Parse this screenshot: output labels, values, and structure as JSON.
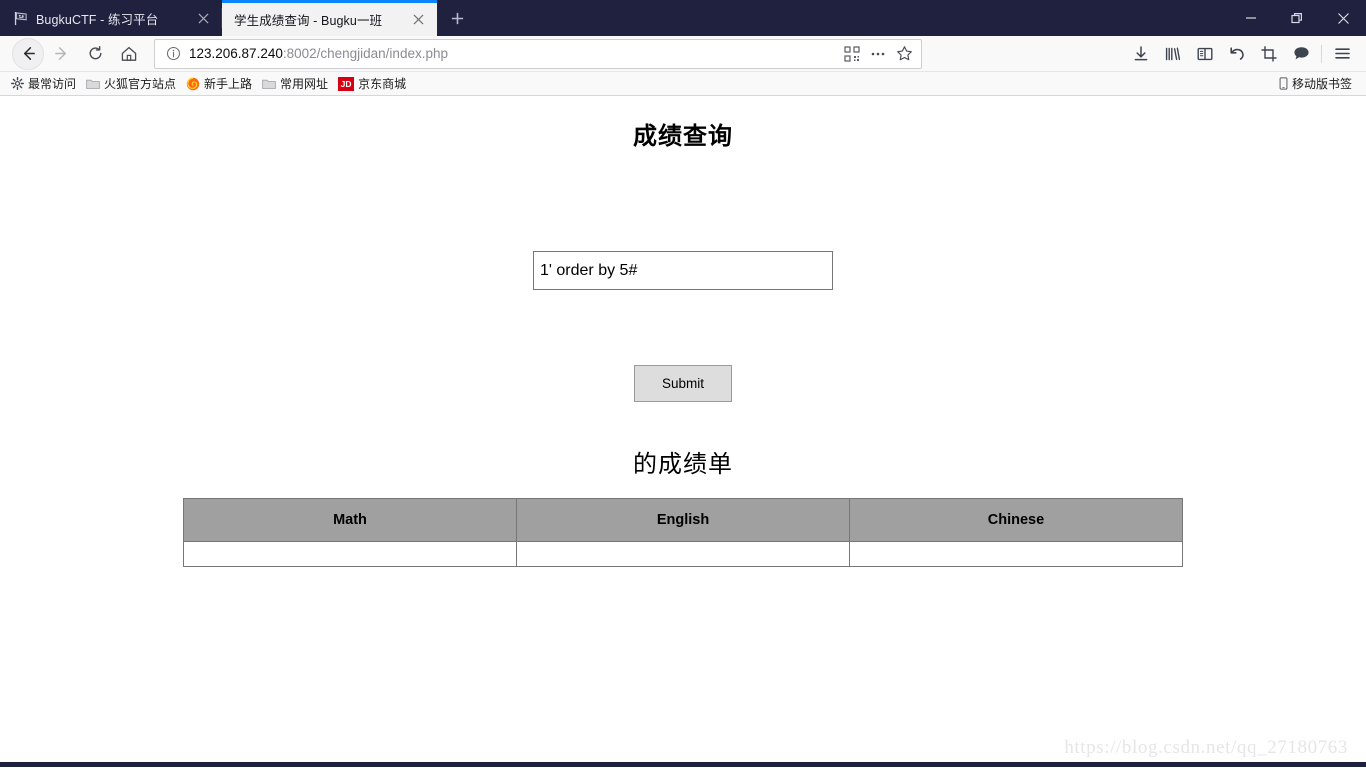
{
  "browser": {
    "tabs": [
      {
        "title": "BugkuCTF - 练习平台",
        "favicon": "pirate-flag-icon",
        "active": false,
        "close_label": "✕"
      },
      {
        "title": "学生成绩查询 - Bugku一班",
        "favicon": "page-icon",
        "active": true,
        "close_label": "✕"
      }
    ],
    "new_tab_label": "+",
    "window_controls": {
      "minimize": "—",
      "restore": "❐",
      "close": "✕"
    },
    "nav": {
      "back": "back-arrow-icon",
      "forward": "forward-arrow-icon",
      "reload": "reload-icon",
      "home": "home-icon"
    },
    "address_bar": {
      "identity_icon": "info-circle-icon",
      "url_host": "123.206.87.240",
      "url_path": ":8002/chengjidan/index.php",
      "placeholder": "搜索或输入网址",
      "qr_icon": "qr-code-icon",
      "more_icon": "ellipsis-icon",
      "bookmark_icon": "star-icon"
    },
    "toolbar_icons": [
      {
        "name": "downloads-icon"
      },
      {
        "name": "library-icon"
      },
      {
        "name": "sidebar-icon"
      },
      {
        "name": "undo-close-tab-icon"
      },
      {
        "name": "screenshot-crop-icon"
      },
      {
        "name": "chat-bubble-icon"
      },
      {
        "name": "hamburger-menu-icon"
      }
    ],
    "bookmarks": [
      {
        "label": "最常访问",
        "icon": "gear-icon"
      },
      {
        "label": "火狐官方站点",
        "icon": "folder-icon"
      },
      {
        "label": "新手上路",
        "icon": "firefox-icon"
      },
      {
        "label": "常用网址",
        "icon": "folder-icon"
      },
      {
        "label": "京东商城",
        "icon": "jd-icon",
        "badge": "JD"
      }
    ],
    "bookmarks_right": {
      "label": "移动版书签",
      "icon": "mobile-icon"
    }
  },
  "page": {
    "title": "成绩查询",
    "query": {
      "value": "1' order by 5#",
      "placeholder": ""
    },
    "submit_label": "Submit",
    "report_title": "的成绩单",
    "table": {
      "headers": [
        "Math",
        "English",
        "Chinese"
      ],
      "rows": [
        [
          "",
          "",
          ""
        ]
      ]
    },
    "watermark": "https://blog.csdn.net/qq_27180763"
  }
}
